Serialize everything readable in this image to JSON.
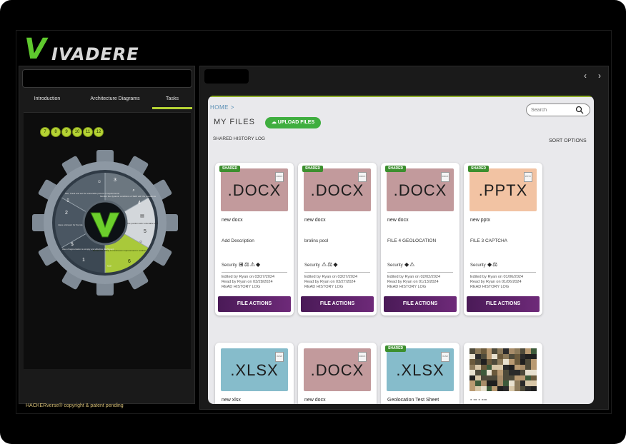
{
  "logo": {
    "first": "V",
    "rest": "IVADERE"
  },
  "left_tabs": [
    {
      "label": "Introduction"
    },
    {
      "label": "Architecture Diagrams"
    },
    {
      "label": "Tasks"
    }
  ],
  "chips": [
    "7",
    "8",
    "9",
    "10",
    "11",
    "12"
  ],
  "gear": {
    "segments": [
      {
        "num": "1",
        "text": "Use a fragmentation to simply and effective dashboard"
      },
      {
        "num": "2",
        "text": "Have unknown for the identifying plans"
      },
      {
        "num": "3",
        "text": "See, Track and set the vulnerable picture of requirements"
      },
      {
        "num": "4",
        "text": "Monitor the dynamic conditions of SEM with the operations"
      },
      {
        "num": "5",
        "text": "Deploy changes in the position with vulnerable data"
      },
      {
        "num": "6",
        "text": "Review the ability to continuous improvement in solution"
      }
    ]
  },
  "copyright": "HACKERverse® copyright & patent pending",
  "files": {
    "breadcrumb": "HOME >",
    "title": "MY FILES",
    "upload_label": "UPLOAD FILES",
    "search_placeholder": "Search",
    "history_link": "SHARED HISTORY LOG",
    "sort_label": "SORT OPTIONS",
    "cards": [
      {
        "ext": ".DOCX",
        "shared": "SHARED",
        "name": "new docx",
        "desc": "Add Description",
        "security": "Security",
        "icons": "⊞⚖⚠◆",
        "edited": "Edited by Ryan on 03/27/2024",
        "read": "Read by Ryan on 03/28/2024",
        "log": "READ HISTORY LOG",
        "actions": "FILE ACTIONS"
      },
      {
        "ext": ".DOCX",
        "shared": "SHARED",
        "name": "new docx",
        "desc": "brolins pool",
        "security": "Security",
        "icons": "⚠⚖◆",
        "edited": "Edited by Ryan on 03/27/2024",
        "read": "Read by Ryan on 03/27/2024",
        "log": "READ HISTORY LOG",
        "actions": "FILE ACTIONS"
      },
      {
        "ext": ".DOCX",
        "shared": "SHARED",
        "name": "new docx",
        "desc": "FILE 4 GEOLOCATION",
        "security": "Security",
        "icons": "◆⚠",
        "edited": "Edited by Ryan on 02/02/2024",
        "read": "Read by Ryan on 01/13/2024",
        "log": "READ HISTORY LOG",
        "actions": "FILE ACTIONS"
      },
      {
        "ext": ".PPTX",
        "shared": "SHARED",
        "name": "new pptx",
        "desc": "FILE 3 CAPTCHA",
        "security": "Security",
        "icons": "◆⚖",
        "edited": "Edited by Ryan on 01/06/2024",
        "read": "Read by Ryan on 01/06/2024",
        "log": "READ HISTORY LOG",
        "actions": "FILE ACTIONS"
      },
      {
        "ext": ".XLSX",
        "shared": "",
        "name": "new xlsx"
      },
      {
        "ext": ".DOCX",
        "shared": "",
        "name": "new docx"
      },
      {
        "ext": ".XLSX",
        "shared": "SHARED",
        "name": "Geolocation Test Sheet"
      },
      {
        "ext": "",
        "shared": "",
        "name": ""
      }
    ]
  },
  "colors": {
    "accent_green": "#b5d334",
    "docx_thumb": "#c29a9c",
    "pptx_thumb": "#f2c3a3",
    "xlsx_thumb": "#86bccb",
    "action_purple": "#5b2068"
  }
}
